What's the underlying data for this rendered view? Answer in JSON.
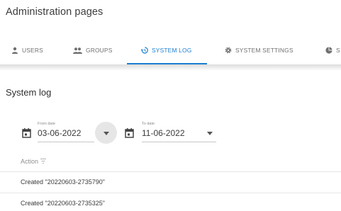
{
  "page": {
    "title": "Administration pages"
  },
  "tabs": [
    {
      "label": "USERS",
      "icon": "user-icon",
      "active": false
    },
    {
      "label": "GROUPS",
      "icon": "groups-icon",
      "active": false
    },
    {
      "label": "SYSTEM LOG",
      "icon": "history-icon",
      "active": true
    },
    {
      "label": "SYSTEM SETTINGS",
      "icon": "gear-icon",
      "active": false
    },
    {
      "label": "S",
      "icon": "pie-chart-icon",
      "active": false
    }
  ],
  "accent_color": "#1b7ed0",
  "system_log": {
    "title": "System log",
    "from_date": {
      "label": "From date",
      "value": "03-06-2022"
    },
    "to_date": {
      "label": "To date",
      "value": "11-06-2022"
    },
    "column_header": "Action",
    "rows": [
      "Created \"20220603-2735790\"",
      "Created \"20220603-2735325\""
    ]
  }
}
